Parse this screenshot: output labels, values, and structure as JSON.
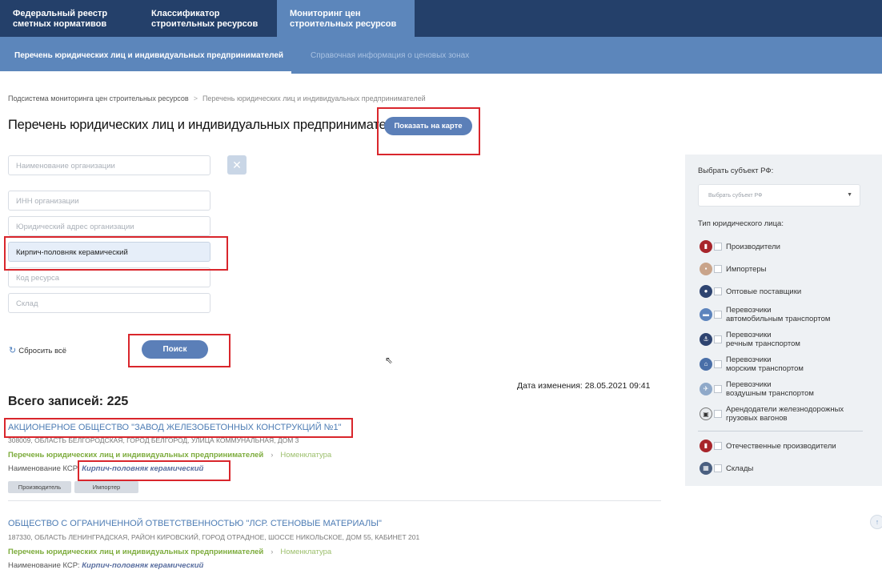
{
  "top_nav": {
    "tabs": [
      {
        "line1": "Федеральный реестр",
        "line2": "сметных нормативов"
      },
      {
        "line1": "Классификатор",
        "line2": "строительных ресурсов"
      },
      {
        "line1": "Мониторинг цен",
        "line2": "строительных ресурсов"
      }
    ]
  },
  "sub_nav": {
    "active": "Перечень юридических лиц и индивидуальных предпринимателей",
    "inactive": "Справочная информация о ценовых зонах"
  },
  "breadcrumb": {
    "root": "Подсистема мониторинга цен строительных ресурсов",
    "separator": ">",
    "current": "Перечень юридических лиц и индивидуальных предпринимателей"
  },
  "page": {
    "title": "Перечень юридических лиц и индивидуальных предпринимателей",
    "show_map_button": "Показать на карте"
  },
  "filters": {
    "org_name_placeholder": "Наименование организации",
    "inn_placeholder": "ИНН организации",
    "address_placeholder": "Юридический адрес организации",
    "resource_name_value": "Кирпич-половняк керамический",
    "resource_code_placeholder": "Код ресурса",
    "warehouse_placeholder": "Склад",
    "clear_icon": "close-icon",
    "reset_label": "Сбросить всё",
    "search_button": "Поиск"
  },
  "results": {
    "date_changed": "Дата изменения: 28.05.2021 09:41",
    "total": "Всего записей: 225",
    "records": [
      {
        "name": "АКЦИОНЕРНОЕ ОБЩЕСТВО \"ЗАВОД ЖЕЛЕЗОБЕТОННЫХ КОНСТРУКЦИЙ №1\"",
        "address": "308009, ОБЛАСТЬ БЕЛГОРОДСКАЯ, ГОРОД БЕЛГОРОД, УЛИЦА КОММУНАЛЬНАЯ, ДОМ 3",
        "link_list": "Перечень юридических лиц и индивидуальных предпринимателей",
        "link_nomenclature": "Номенклатура",
        "ksr_label": "Наименование КСР:",
        "ksr_value": "Кирпич-половняк керамический",
        "tags": [
          "Производитель",
          "Импортер"
        ]
      },
      {
        "name": "ОБЩЕСТВО С ОГРАНИЧЕННОЙ ОТВЕТСТВЕННОСТЬЮ \"ЛСР. СТЕНОВЫЕ МАТЕРИАЛЫ\"",
        "address": "187330, ОБЛАСТЬ ЛЕНИНГРАДСКАЯ, РАЙОН КИРОВСКИЙ, ГОРОД ОТРАДНОЕ, ШОССЕ НИКОЛЬСКОЕ, ДОМ 55, КАБИНЕТ 201",
        "link_list": "Перечень юридических лиц и индивидуальных предпринимателей",
        "link_nomenclature": "Номенклатура",
        "ksr_label": "Наименование КСР:",
        "ksr_value": "Кирпич-половняк керамический"
      }
    ]
  },
  "side_panel": {
    "subject_label": "Выбрать субъект РФ:",
    "subject_placeholder": "Выбрать субъект РФ",
    "type_label": "Тип юридического лица:",
    "types": [
      {
        "icon": "factory-icon",
        "color": "#a8252b",
        "line1": "Производители",
        "line2": ""
      },
      {
        "icon": "package-icon",
        "color": "#c9a48a",
        "line1": "Импортеры",
        "line2": ""
      },
      {
        "icon": "people-icon",
        "color": "#2e4470",
        "line1": "Оптовые поставщики",
        "line2": ""
      },
      {
        "icon": "truck-icon",
        "color": "#5d84bd",
        "line1": "Перевозчики",
        "line2": "автомобильным транспортом"
      },
      {
        "icon": "anchor-icon",
        "color": "#2e4470",
        "line1": "Перевозчики",
        "line2": "речным транспортом"
      },
      {
        "icon": "ship-icon",
        "color": "#4a6fa8",
        "line1": "Перевозчики",
        "line2": "морским транспортом"
      },
      {
        "icon": "plane-icon",
        "color": "#8fa9c9",
        "line1": "Перевозчики",
        "line2": "воздушным транспортом"
      },
      {
        "icon": "railcar-icon",
        "color": "#e9ecef",
        "line1": "Арендодатели железнодорожных",
        "line2": "грузовых вагонов"
      }
    ],
    "extra": [
      {
        "icon": "domestic-producer-icon",
        "color": "#a8252b",
        "line1": "Отечественные производители"
      },
      {
        "icon": "warehouse-icon",
        "color": "#4a5f80",
        "line1": "Склады"
      }
    ]
  },
  "scroll_top_icon": "arrow-up-icon"
}
